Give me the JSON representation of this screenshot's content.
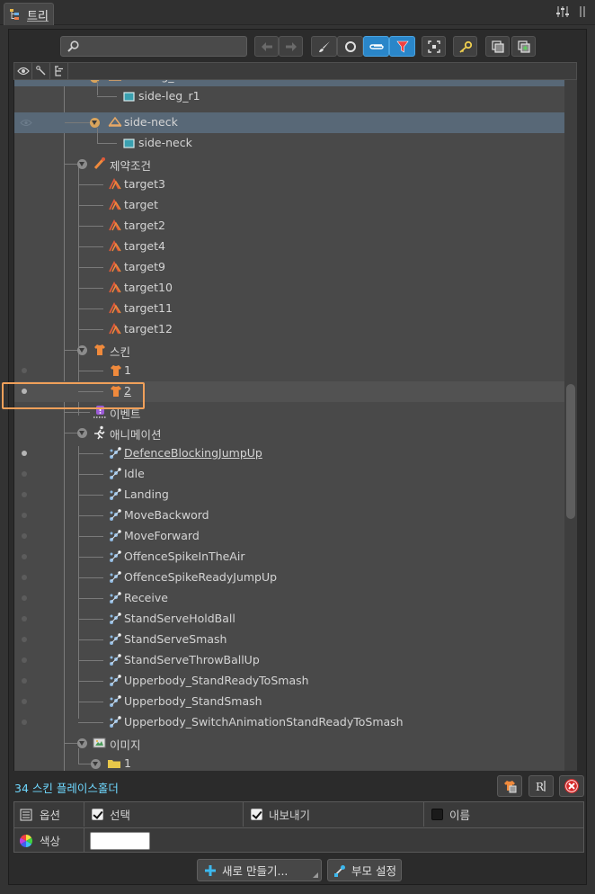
{
  "tab": {
    "title": "트리"
  },
  "toolbar": {
    "search_placeholder": "",
    "icons": [
      "search-icon",
      "arrow-left-icon",
      "arrow-right-icon",
      "brush-icon",
      "circle-icon",
      "paperclip-icon",
      "filter-icon",
      "focus-icon",
      "key-icon",
      "window-icon",
      "window-add-icon"
    ]
  },
  "tree_header": {
    "icons": [
      "eye-icon",
      "bone-icon",
      "hierarchy-icon"
    ]
  },
  "tree": {
    "rows": [
      {
        "label": "side-leg_r1",
        "icon": "bone-icon",
        "level": "slot"
      },
      {
        "label": "side-leg_r1",
        "icon": "attachment-icon",
        "level": "attachment"
      },
      {
        "label": "side-neck",
        "icon": "bone-icon",
        "level": "slot"
      },
      {
        "label": "side-neck",
        "icon": "attachment-icon",
        "level": "attachment"
      },
      {
        "label": "제약조건",
        "icon": "constraint-icon",
        "level": "group"
      },
      {
        "label": "target3",
        "icon": "ik-icon"
      },
      {
        "label": "target",
        "icon": "ik-icon"
      },
      {
        "label": "target2",
        "icon": "ik-icon"
      },
      {
        "label": "target4",
        "icon": "ik-icon"
      },
      {
        "label": "target9",
        "icon": "ik-icon"
      },
      {
        "label": "target10",
        "icon": "ik-icon"
      },
      {
        "label": "target11",
        "icon": "ik-icon"
      },
      {
        "label": "target12",
        "icon": "ik-icon"
      },
      {
        "label": "스킨",
        "icon": "skin-icon",
        "level": "group"
      },
      {
        "label": "1",
        "icon": "skin-icon"
      },
      {
        "label": "2",
        "icon": "skin-icon"
      },
      {
        "label": "이벤트",
        "icon": "event-icon",
        "level": "group"
      },
      {
        "label": "애니메이션",
        "icon": "animation-icon",
        "level": "group"
      },
      {
        "label": "DefenceBlockingJumpUp",
        "icon": "anim-clip-icon"
      },
      {
        "label": "Idle",
        "icon": "anim-clip-icon"
      },
      {
        "label": "Landing",
        "icon": "anim-clip-icon"
      },
      {
        "label": "MoveBackword",
        "icon": "anim-clip-icon"
      },
      {
        "label": "MoveForward",
        "icon": "anim-clip-icon"
      },
      {
        "label": "OffenceSpikeInTheAir",
        "icon": "anim-clip-icon"
      },
      {
        "label": "OffenceSpikeReadyJumpUp",
        "icon": "anim-clip-icon"
      },
      {
        "label": "Receive",
        "icon": "anim-clip-icon"
      },
      {
        "label": "StandServeHoldBall",
        "icon": "anim-clip-icon"
      },
      {
        "label": "StandServeSmash",
        "icon": "anim-clip-icon"
      },
      {
        "label": "StandServeThrowBallUp",
        "icon": "anim-clip-icon"
      },
      {
        "label": "Upperbody_StandReadyToSmash",
        "icon": "anim-clip-icon"
      },
      {
        "label": "Upperbody_StandSmash",
        "icon": "anim-clip-icon"
      },
      {
        "label": "Upperbody_SwitchAnimationStandReadyToSmash",
        "icon": "anim-clip-icon"
      },
      {
        "label": "이미지",
        "icon": "image-folder-icon",
        "level": "group"
      },
      {
        "label": "1",
        "icon": "folder-icon"
      }
    ]
  },
  "status": {
    "text": "34 스킨 플레이스홀더"
  },
  "props": {
    "options_label": "옵션",
    "select_label": "선택",
    "export_label": "내보내기",
    "name_label": "이름",
    "color_label": "색상",
    "color_value": "#ffffff"
  },
  "buttons": {
    "new_label": "새로 만들기...",
    "parent_label": "부모 설정"
  },
  "colors": {
    "accent": "#2a86c9",
    "selection": "#586877",
    "highlight_box": "#f0a05a",
    "status_text": "#6fd8ff",
    "bone": "#e7a866",
    "skin": "#f08a3c",
    "ik": "#e05a3a",
    "anim": "#8fb9e0"
  }
}
